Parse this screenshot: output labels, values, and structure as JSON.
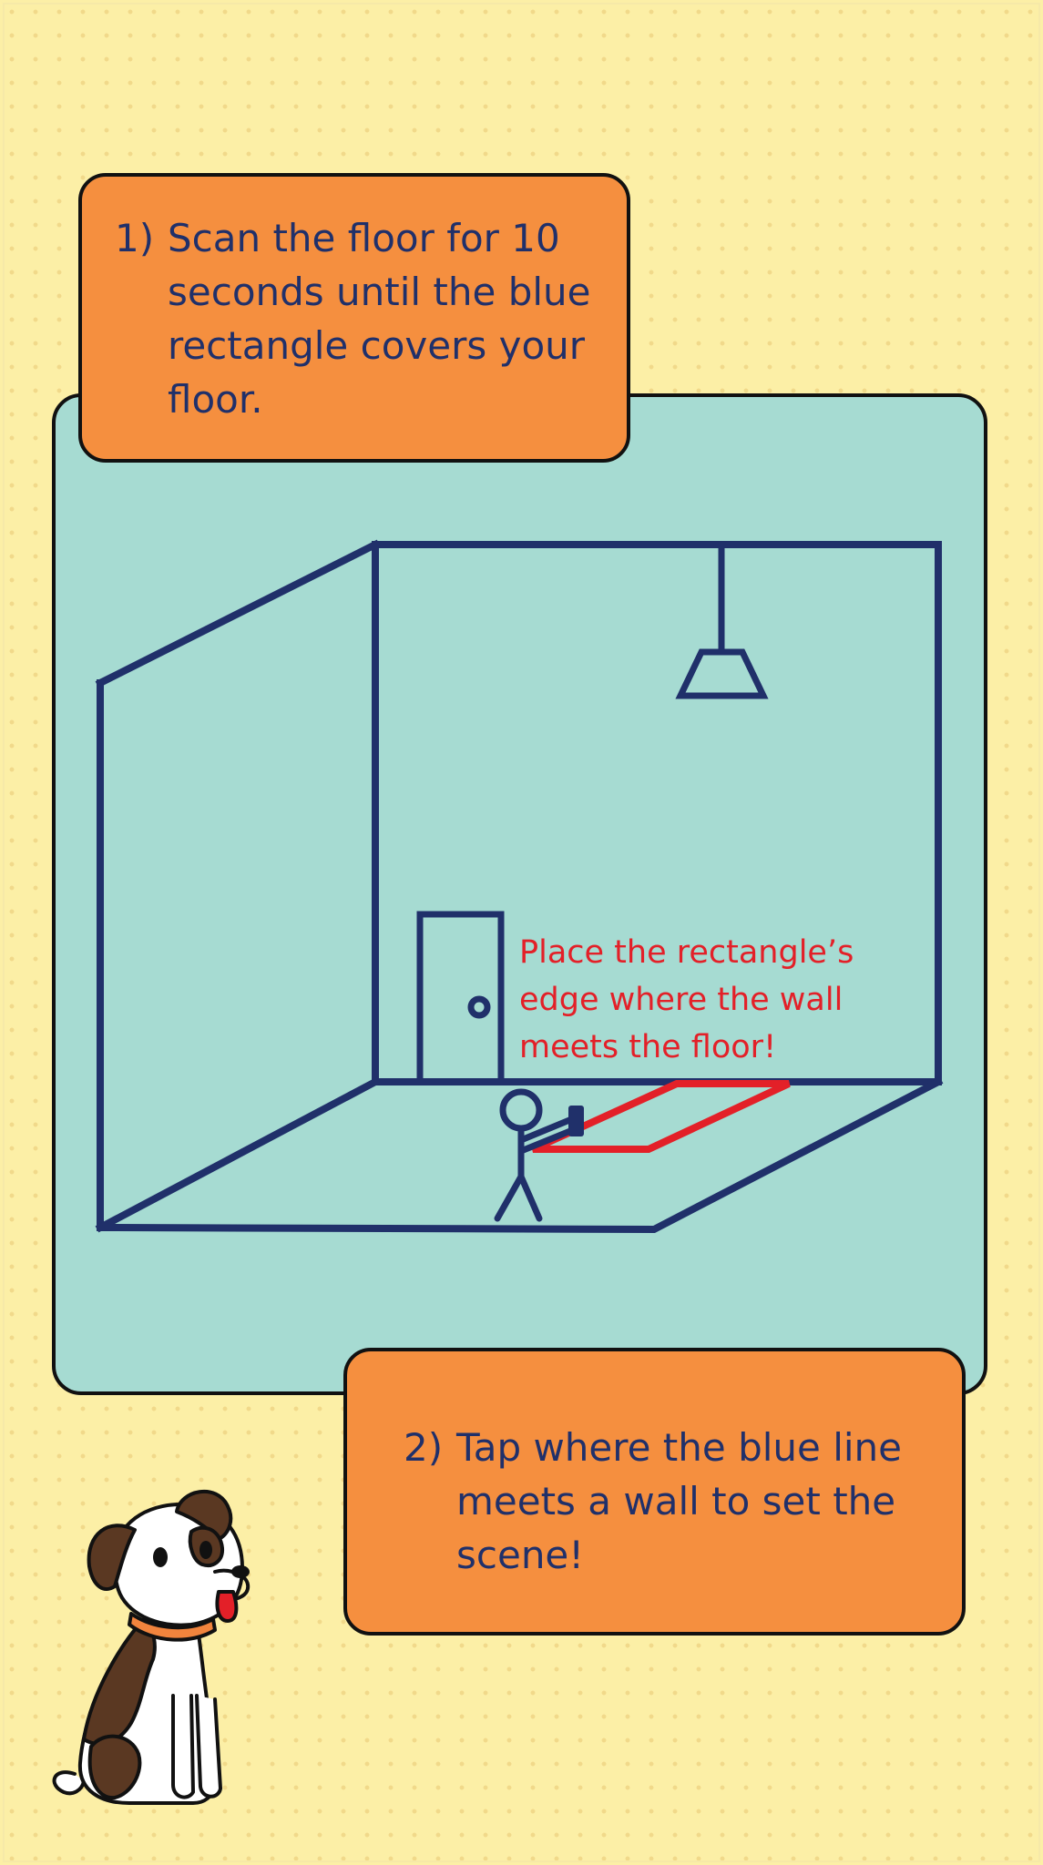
{
  "colors": {
    "background": "#fcefa6",
    "panel": "#a6dbd2",
    "callout": "#f58f3f",
    "navy": "#20306a",
    "accent_red": "#e32028"
  },
  "step1": {
    "number": "1)",
    "text": "Scan the floor for 10 seconds until the blue rectangle covers your floor."
  },
  "scene": {
    "hint": "Place the rectangle’s edge where the wall meets the floor!"
  },
  "step2": {
    "number": "2)",
    "text": "Tap where the blue line meets a wall to set the scene!"
  },
  "icons": [
    "room-illustration",
    "ceiling-lamp-icon",
    "door-icon",
    "stick-figure-icon",
    "phone-icon",
    "placement-rectangle",
    "dog-mascot"
  ]
}
